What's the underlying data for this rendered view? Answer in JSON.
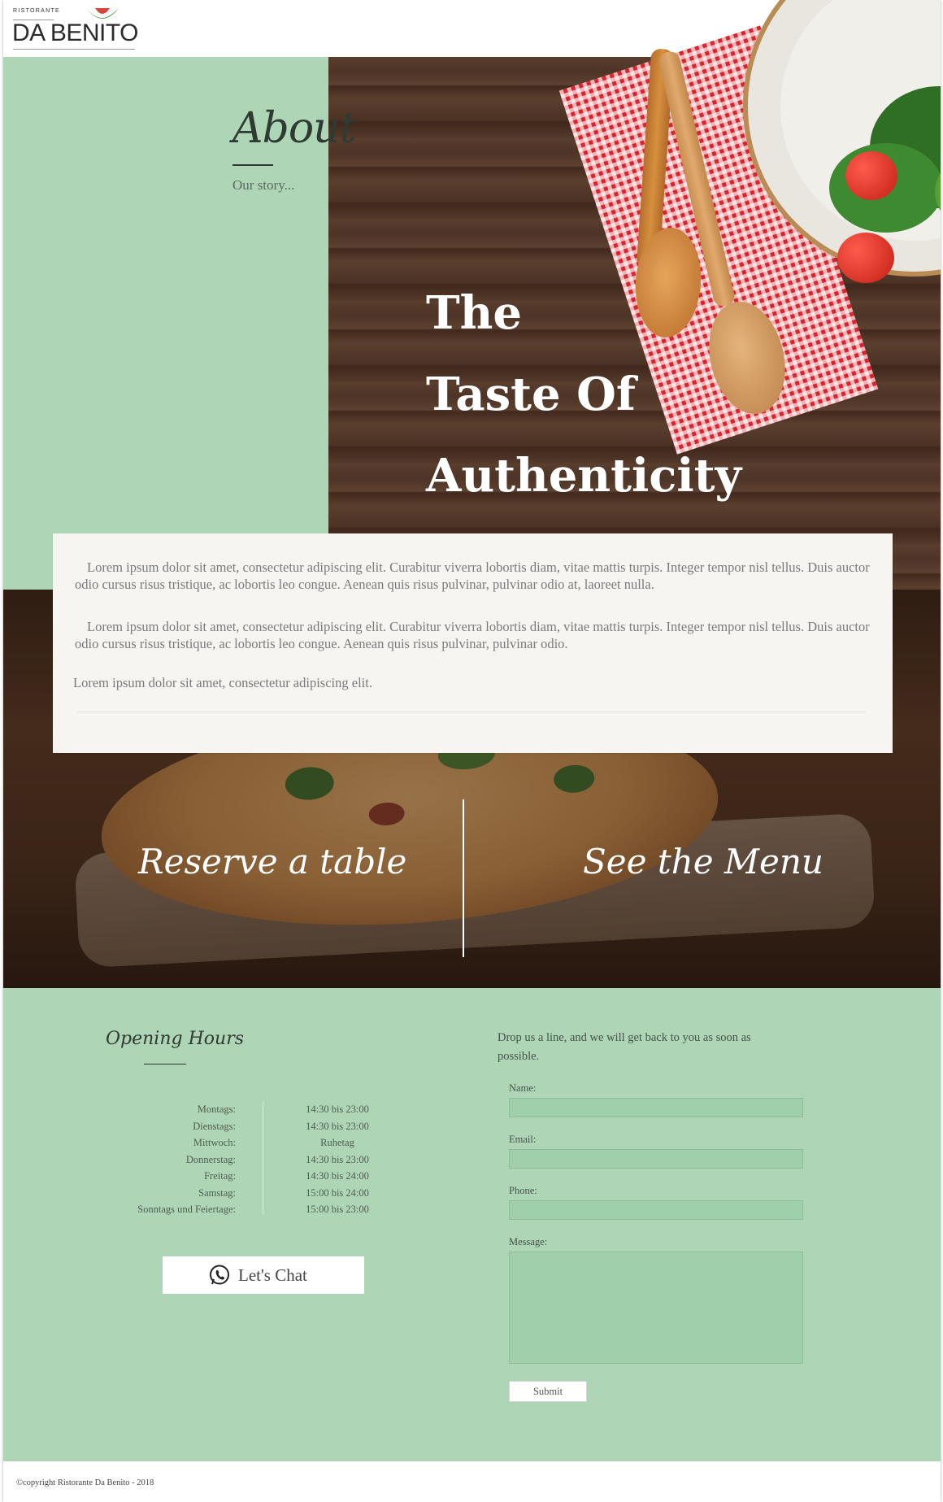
{
  "header": {
    "logo_small": "RISTORANTE",
    "logo_name": "DA BENITO",
    "menu_icon": "hamburger-icon"
  },
  "hero": {
    "about_title": "About",
    "about_subtitle": "Our story...",
    "tagline": [
      "The",
      "Taste Of",
      "Authenticity"
    ]
  },
  "intro": {
    "paragraphs": [
      "Lorem ipsum dolor sit amet, consectetur adipiscing elit. Curabitur viverra lobortis diam, vitae mattis turpis. Integer tempor nisl tellus. Duis auctor odio cursus risus tristique, ac lobortis leo congue. Aenean quis risus pulvinar, pulvinar odio at, laoreet nulla.",
      "Lorem ipsum dolor sit amet, consectetur adipiscing elit. Curabitur viverra lobortis diam, vitae mattis turpis. Integer tempor nisl tellus. Duis auctor odio cursus risus tristique, ac lobortis leo congue. Aenean quis risus pulvinar, pulvinar odio.",
      "Lorem ipsum dolor sit amet, consectetur adipiscing elit."
    ]
  },
  "cta": {
    "reserve": "Reserve a table",
    "menu": "See the Menu"
  },
  "hours": {
    "title": "Opening Hours",
    "rows": [
      {
        "day": "Montags:",
        "time": "14:30 bis 23:00"
      },
      {
        "day": "Dienstags:",
        "time": "14:30 bis 23:00"
      },
      {
        "day": "Mittwoch:",
        "time": "Ruhetag"
      },
      {
        "day": "Donnerstag:",
        "time": "14:30 bis 23:00"
      },
      {
        "day": "Freitag:",
        "time": "14:30 bis 24:00"
      },
      {
        "day": "Samstag:",
        "time": "15:00 bis 24:00"
      },
      {
        "day": "Sonntags und Feiertage:",
        "time": "15:00 bis 23:00"
      }
    ],
    "chat_label": "Let's Chat",
    "chat_icon": "whatsapp-icon"
  },
  "contact": {
    "intro": "Drop us a line, and we will get back to you as soon as possible.",
    "name_label": "Name:",
    "email_label": "Email:",
    "phone_label": "Phone:",
    "message_label": "Message:",
    "submit_label": "Submit"
  },
  "footer": {
    "copyright": "©copyright Ristorante Da Benito - 2018"
  },
  "colors": {
    "green": "#afd5b7",
    "field_green": "#9fcfab",
    "card_bg": "#f7f5f1"
  }
}
